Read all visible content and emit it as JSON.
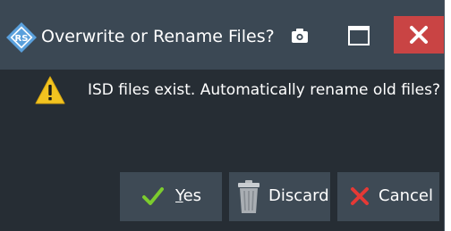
{
  "dialog": {
    "title": "Overwrite or Rename Files?",
    "message": "ISD files exist. Automatically rename old files?",
    "icons": {
      "logo": "rohde-schwarz-logo-icon",
      "camera": "camera-icon",
      "maximize": "maximize-icon",
      "close": "close-icon",
      "warning": "warning-icon"
    }
  },
  "buttons": {
    "yes": {
      "label_first": "Y",
      "label_rest": "es",
      "icon": "checkmark-icon"
    },
    "discard": {
      "label": "Discard",
      "icon": "trash-icon"
    },
    "cancel": {
      "label": "Cancel",
      "icon": "cancel-x-icon"
    }
  },
  "colors": {
    "titlebar": "#3b4854",
    "body": "#262d34",
    "close": "#c94444",
    "button": "#3e4a55",
    "check": "#7ccc2e",
    "cancel_x": "#e53935",
    "warning": "#f2c320"
  }
}
